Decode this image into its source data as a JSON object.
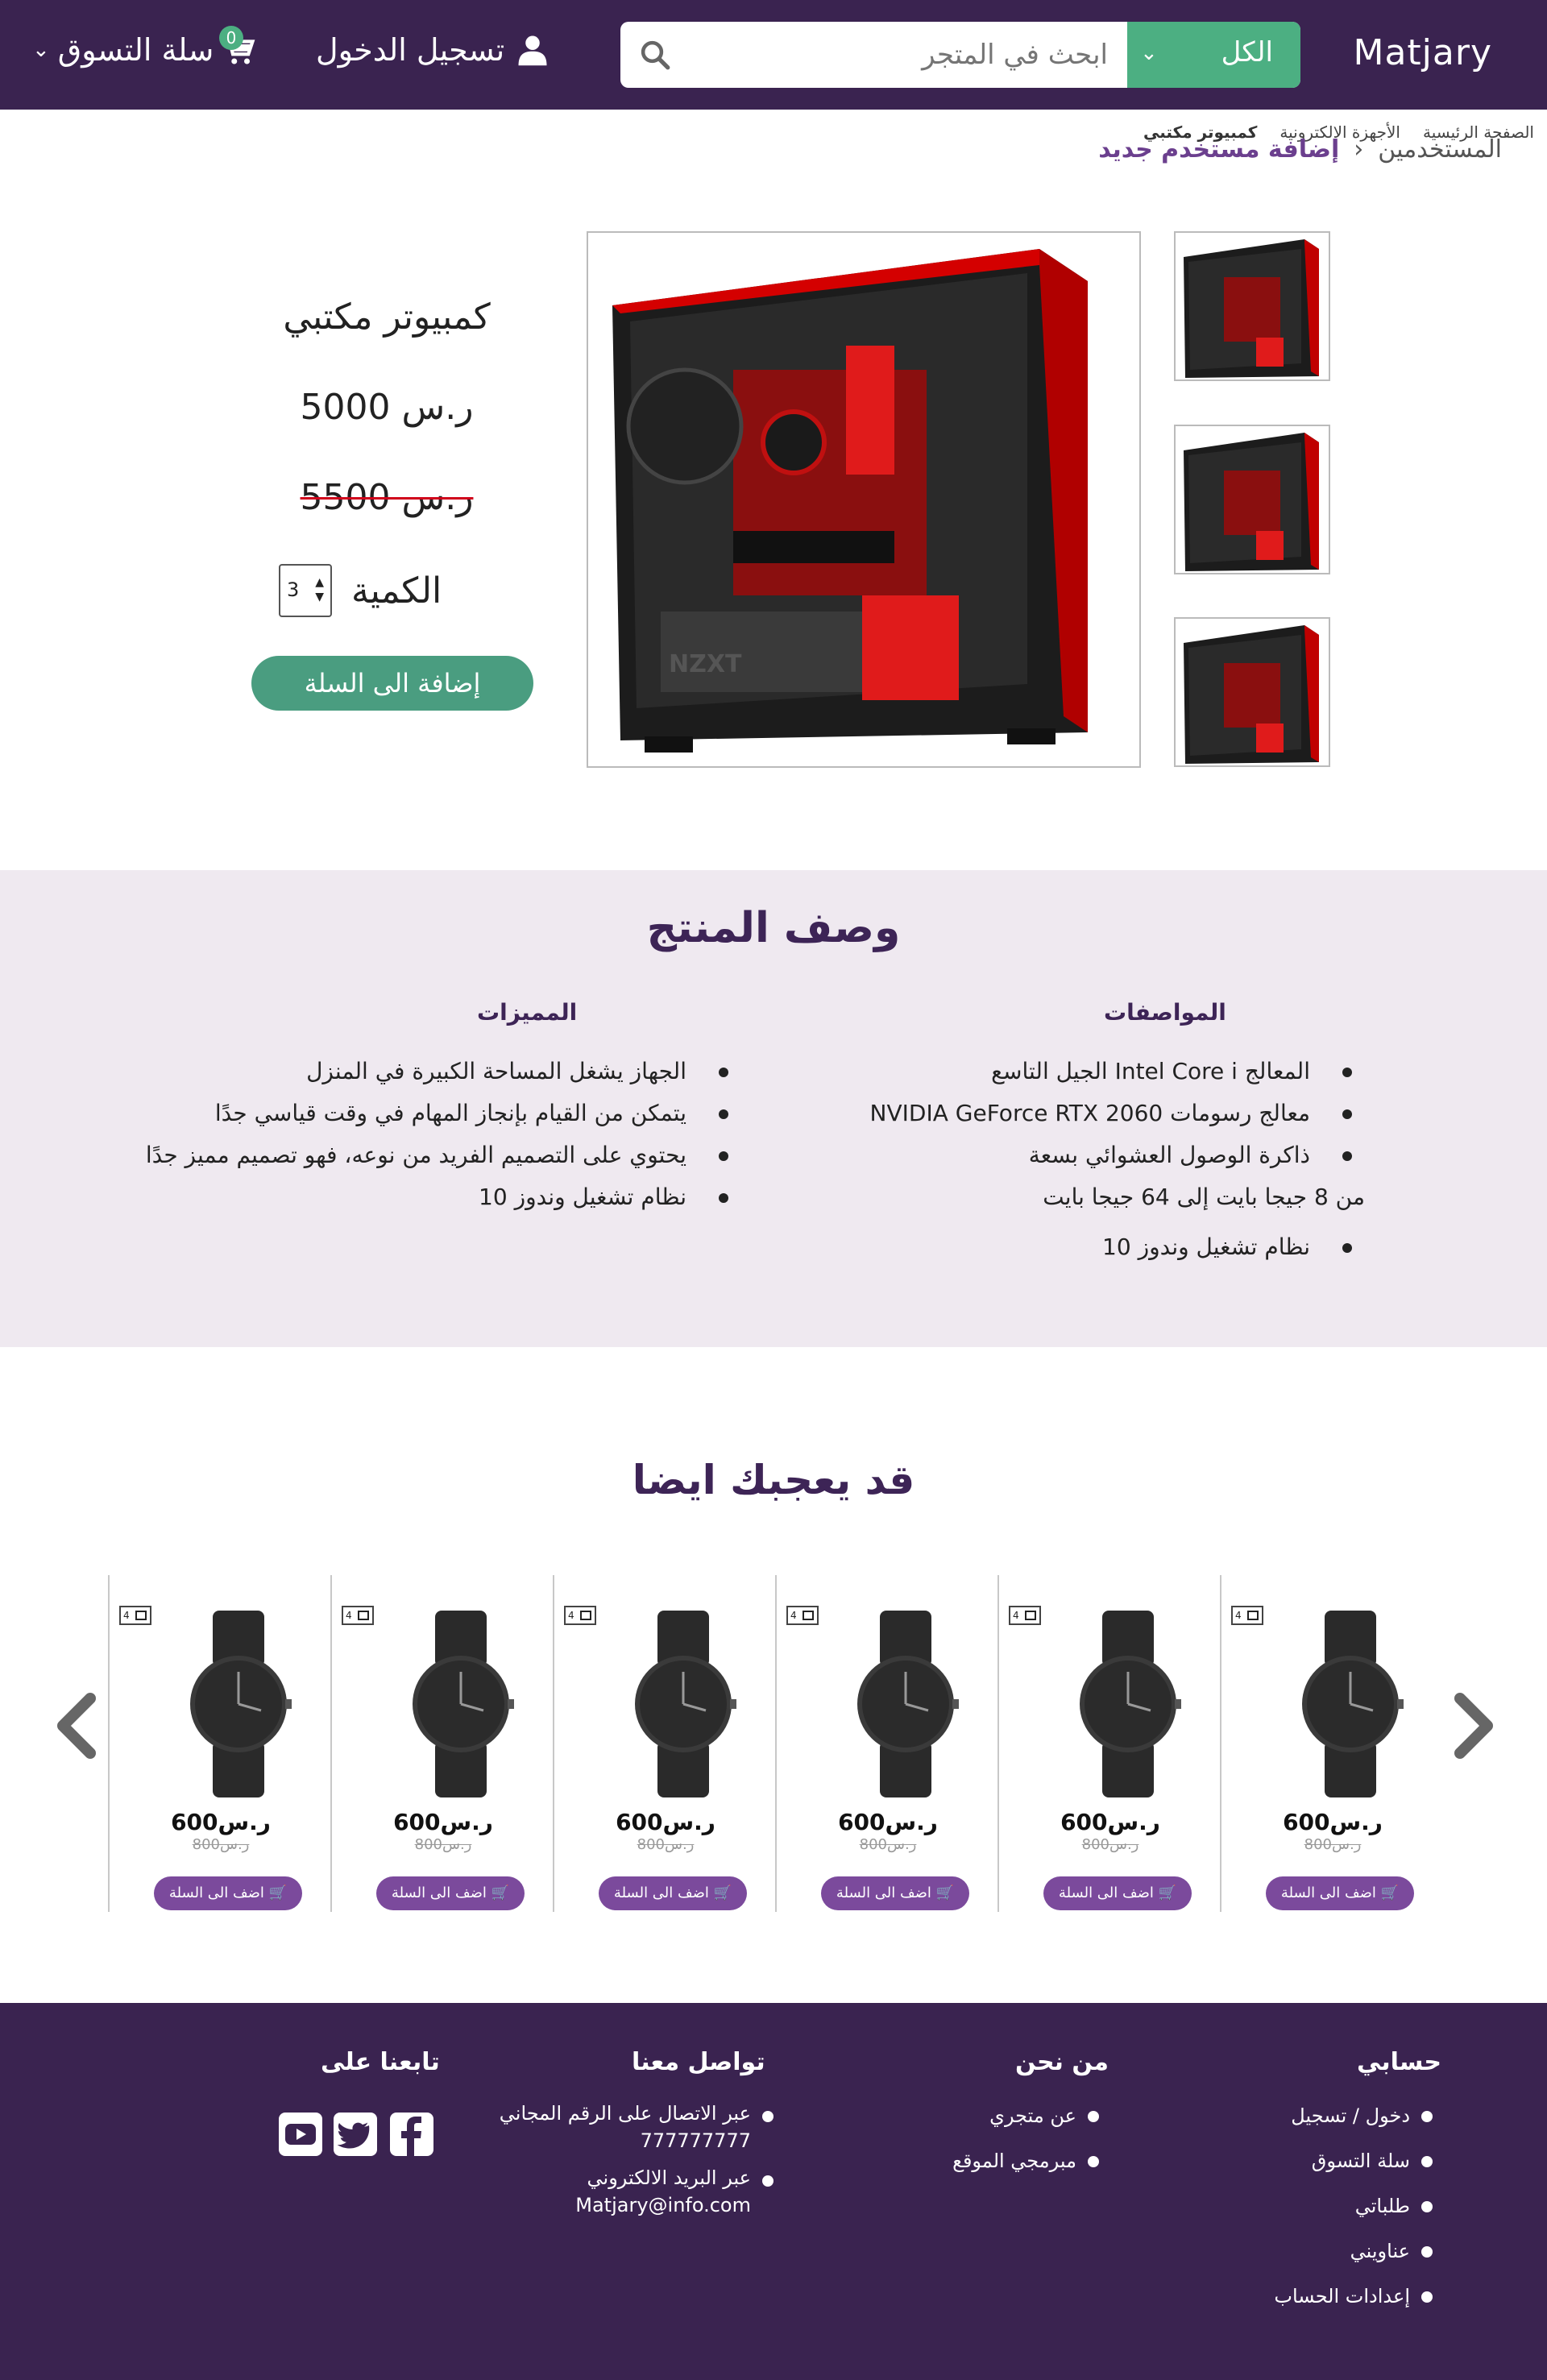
{
  "navbar": {
    "brand": "Matjary",
    "search": {
      "category": "الكل",
      "placeholder": "ابحث في المتجر"
    },
    "login": "تسجيل الدخول",
    "cart": "سلة التسوق",
    "cart_count": "0"
  },
  "breadcrumb": {
    "top": [
      "الصفحة الرئيسية",
      "الأجهزة الالكترونية",
      "كمبيوتر مكتبي"
    ],
    "bottom_parent": "المستخدمين",
    "bottom_separator": "‹",
    "bottom_current": "إضافة مستخدم جديد"
  },
  "product": {
    "name": "كمبيوتر مكتبي",
    "price": "5000 ر.س",
    "old_price": "5500 ر.س",
    "quantity_label": "الكمية",
    "quantity": "3",
    "add_to_cart": "إضافة الى السلة",
    "case_brand": "NZXT"
  },
  "description": {
    "title": "وصف المنتج",
    "specs_title": "المواصفات",
    "specs": [
      {
        "text": "المعالج Intel Core i  الجيل التاسع",
        "bullet": true
      },
      {
        "text": "معالج رسومات NVIDIA GeForce RTX 2060",
        "bullet": true
      },
      {
        "text": "ذاكرة الوصول العشوائي بسعة",
        "bullet": true
      },
      {
        "text": "من 8 جيجا بايت إلى 64 جيجا بايت",
        "bullet": false
      },
      {
        "text": "نظام تشغيل وندوز 10",
        "bullet": true
      }
    ],
    "features_title": "المميزات",
    "features": [
      "الجهاز يشغل المساحة الكبيرة في المنزل",
      "يتمكن من القيام بإنجاز المهام في وقت قياسي جدًا",
      "يحتوي على التصميم الفريد من نوعه، فهو تصميم مميز جدًا",
      "نظام تشغيل وندوز 10"
    ]
  },
  "recommended": {
    "title": "قد يعجبك ايضا",
    "items": [
      {
        "price": "600ر.س",
        "old_price": "800ر.س",
        "button": "اضف الى السلة",
        "tag": "4"
      },
      {
        "price": "600ر.س",
        "old_price": "800ر.س",
        "button": "اضف الى السلة",
        "tag": "4"
      },
      {
        "price": "600ر.س",
        "old_price": "800ر.س",
        "button": "اضف الى السلة",
        "tag": "4"
      },
      {
        "price": "600ر.س",
        "old_price": "800ر.س",
        "button": "اضف الى السلة",
        "tag": "4"
      },
      {
        "price": "600ر.س",
        "old_price": "800ر.س",
        "button": "اضف الى السلة",
        "tag": "4"
      },
      {
        "price": "600ر.س",
        "old_price": "800ر.س",
        "button": "اضف الى السلة",
        "tag": "4"
      }
    ]
  },
  "footer": {
    "account_title": "حسابي",
    "account_items": [
      "دخول / تسجيل",
      "سلة التسوق",
      "طلباتي",
      "عناويني",
      "إعدادات الحساب"
    ],
    "about_title": "من نحن",
    "about_items": [
      "عن متجري",
      "مبرمجي الموقع"
    ],
    "contact_title": "تواصل معنا",
    "contact_phone_label": "عبر الاتصال على الرقم المجاني",
    "contact_phone": "777777777",
    "contact_email_label": "عبر البريد الالكتروني",
    "contact_email": "Matjary@info.com",
    "follow_title": "تابعنا على",
    "social_icons": [
      "facebook-icon",
      "twitter-icon",
      "youtube-icon"
    ]
  },
  "colors": {
    "primary": "#3a2350",
    "accent_green": "#4caf82",
    "button_purple": "#7b4a9c",
    "description_bg": "#efe9f0"
  }
}
